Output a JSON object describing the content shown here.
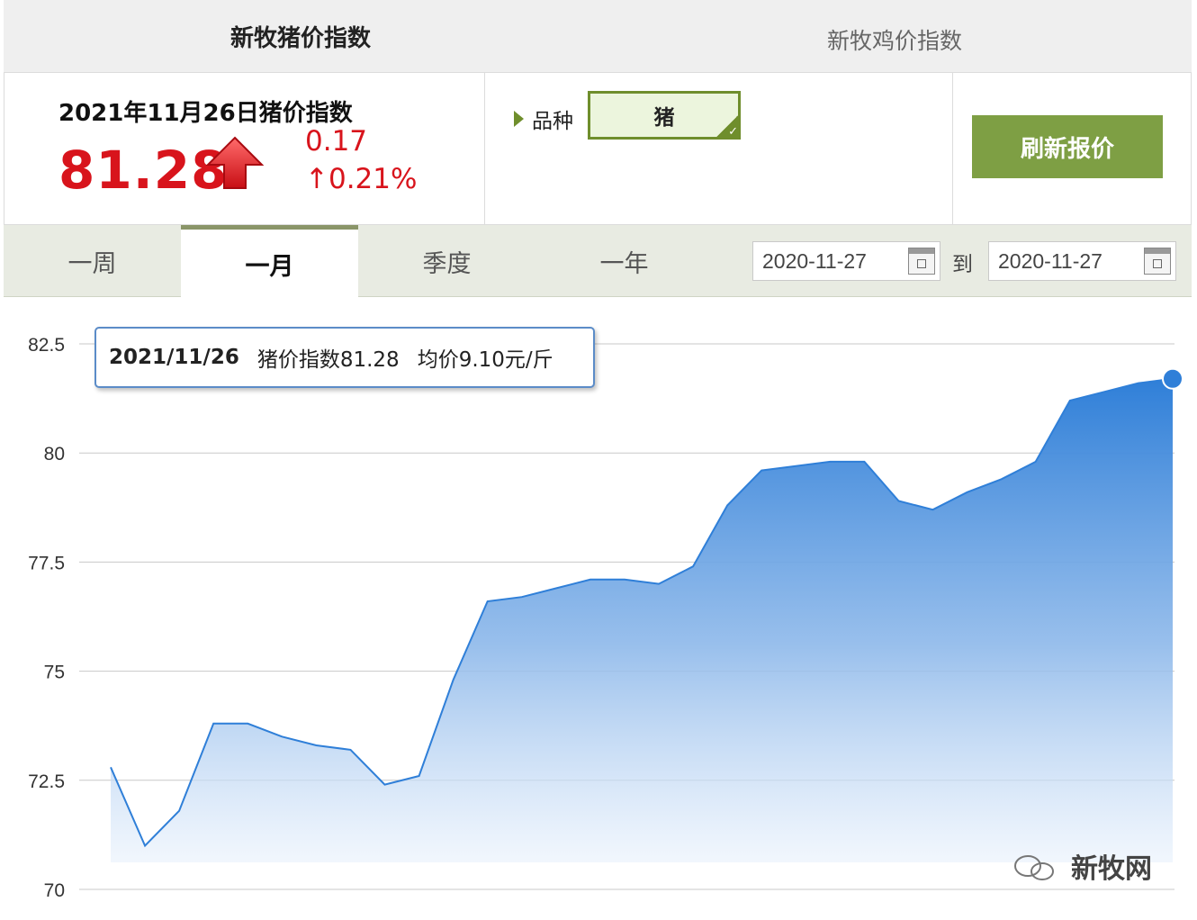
{
  "tabs": {
    "pig_index": "新牧猪价指数",
    "chicken_index": "新牧鸡价指数"
  },
  "summary": {
    "title": "2021年11月26日猪价指数",
    "value": "81.28",
    "change_abs": "0.17",
    "change_pct": "↑0.21%",
    "trend_icon": "up-arrow-icon",
    "trend_color": "#d8141c"
  },
  "variety": {
    "label": "品种",
    "selected": "猪"
  },
  "refresh_button": "刷新报价",
  "periods": [
    "一周",
    "一月",
    "季度",
    "一年"
  ],
  "active_period": "一月",
  "date_range": {
    "start": "2020-11-27",
    "separator": "到",
    "end": "2020-11-27"
  },
  "tooltip": {
    "date": "2021/11/26",
    "index_text": "猪价指数81.28",
    "avg_text": "均价9.10元/斤"
  },
  "watermark": "新牧网",
  "chart_data": {
    "type": "area",
    "title": "",
    "xlabel": "",
    "ylabel": "",
    "ylim": [
      70,
      82.5
    ],
    "yticks": [
      "70",
      "72.5",
      "75",
      "77.5",
      "80",
      "82.5"
    ],
    "grid": true,
    "color": "#3a86dc",
    "series": [
      {
        "values": [
          72.8,
          71.0,
          71.8,
          73.8,
          73.8,
          73.5,
          73.3,
          73.2,
          72.4,
          72.6,
          74.8,
          76.6,
          76.7,
          76.9,
          77.1,
          77.1,
          77.0,
          77.4,
          78.8,
          79.6,
          79.7,
          79.8,
          79.8,
          78.9,
          78.7,
          79.1,
          79.4,
          79.8,
          81.2,
          81.4,
          81.6,
          81.7
        ]
      }
    ],
    "highlight": {
      "index": 31,
      "label": "2021/11/26"
    }
  }
}
